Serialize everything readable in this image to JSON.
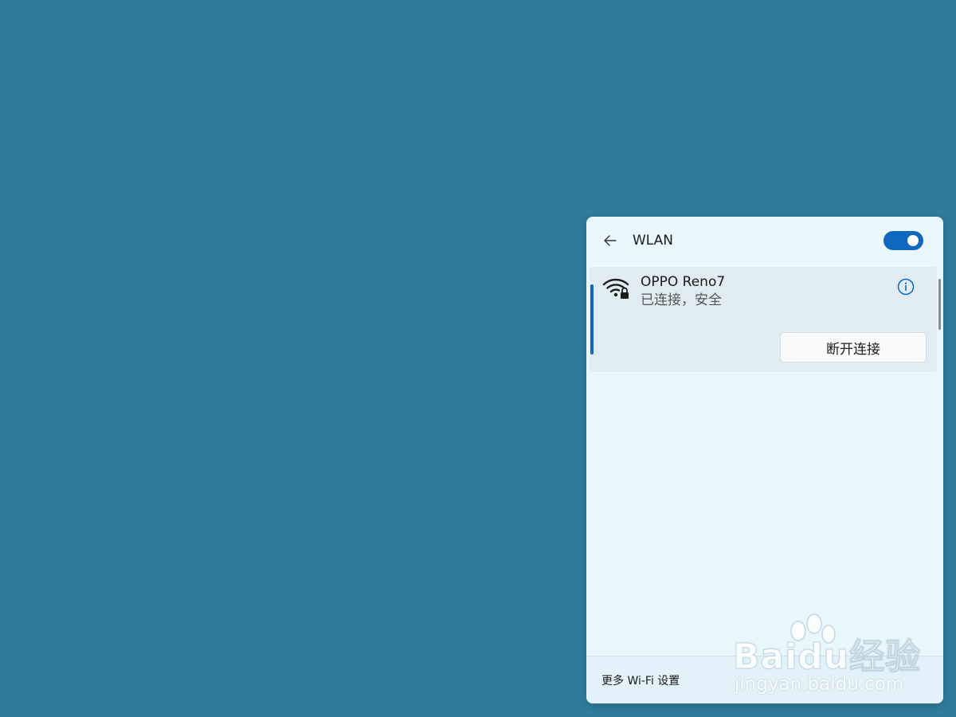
{
  "header": {
    "title": "WLAN",
    "wifi_enabled": true
  },
  "network": {
    "name": "OPPO Reno7",
    "status": "已连接，安全",
    "disconnect_label": "断开连接"
  },
  "footer": {
    "more_settings": "更多 Wi-Fi 设置"
  },
  "watermark": {
    "logo_text": "Baidu经验",
    "url": "jingyan.baidu.com"
  },
  "colors": {
    "desktop": "#2e7c9a",
    "panel": "#e9f6fb",
    "accent": "#0f67c0"
  },
  "icons": {
    "back": "back-arrow-icon",
    "wifi": "wifi-secure-icon",
    "info": "info-icon"
  }
}
